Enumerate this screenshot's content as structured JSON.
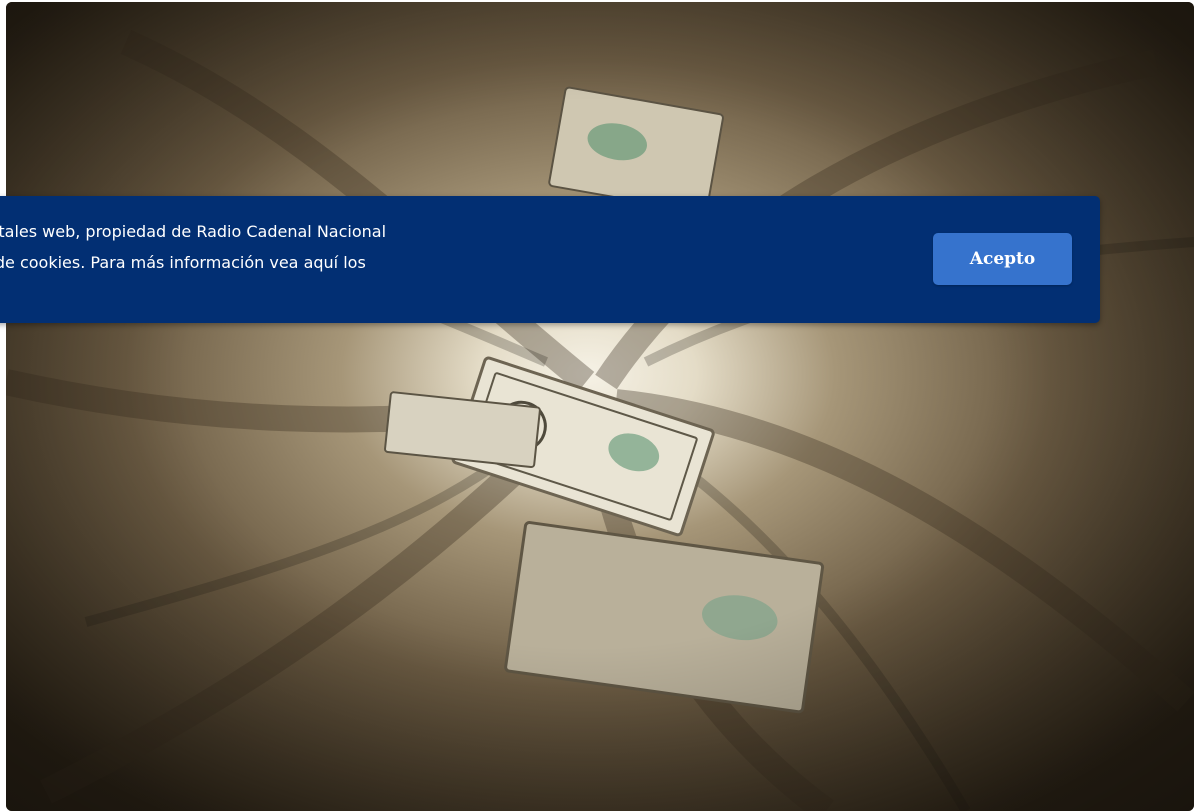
{
  "hero_image": {
    "icon": "money-tunnel-photo",
    "colors": {
      "center": "#f6f2e6",
      "mid": "#a69678",
      "edge": "#2d2417"
    }
  },
  "cookie_banner": {
    "text_line_1": "ortales web, propiedad de Radio Cadenal Nacional",
    "text_line_2": "o de cookies. Para más información vea aquí los",
    "accept_label": "Acepto",
    "colors": {
      "background": "#022f73",
      "button": "#3673cd",
      "text": "#ffffff"
    }
  }
}
